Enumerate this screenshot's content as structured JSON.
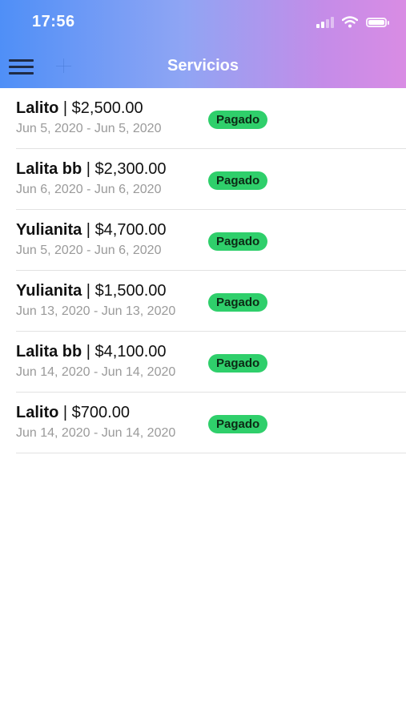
{
  "status_bar": {
    "time": "17:56"
  },
  "header": {
    "title": "Servicios",
    "gradient_start": "#4f8ff7",
    "gradient_end": "#d98ce4"
  },
  "services": [
    {
      "name": "Lalito",
      "separator": " | ",
      "amount": "$2,500.00",
      "dates": "Jun 5, 2020 - Jun 5, 2020",
      "status": "Pagado"
    },
    {
      "name": "Lalita bb",
      "separator": " | ",
      "amount": "$2,300.00",
      "dates": "Jun 6, 2020 - Jun 6, 2020",
      "status": "Pagado"
    },
    {
      "name": "Yulianita",
      "separator": " | ",
      "amount": "$4,700.00",
      "dates": "Jun 5, 2020 - Jun 6, 2020",
      "status": "Pagado"
    },
    {
      "name": "Yulianita",
      "separator": " | ",
      "amount": "$1,500.00",
      "dates": "Jun 13, 2020 - Jun 13, 2020",
      "status": "Pagado"
    },
    {
      "name": "Lalita bb",
      "separator": " | ",
      "amount": "$4,100.00",
      "dates": "Jun 14, 2020 - Jun 14, 2020",
      "status": "Pagado"
    },
    {
      "name": "Lalito",
      "separator": " | ",
      "amount": "$700.00",
      "dates": "Jun 14, 2020 - Jun 14, 2020",
      "status": "Pagado"
    }
  ],
  "colors": {
    "paid_badge": "#2fcf6b"
  }
}
